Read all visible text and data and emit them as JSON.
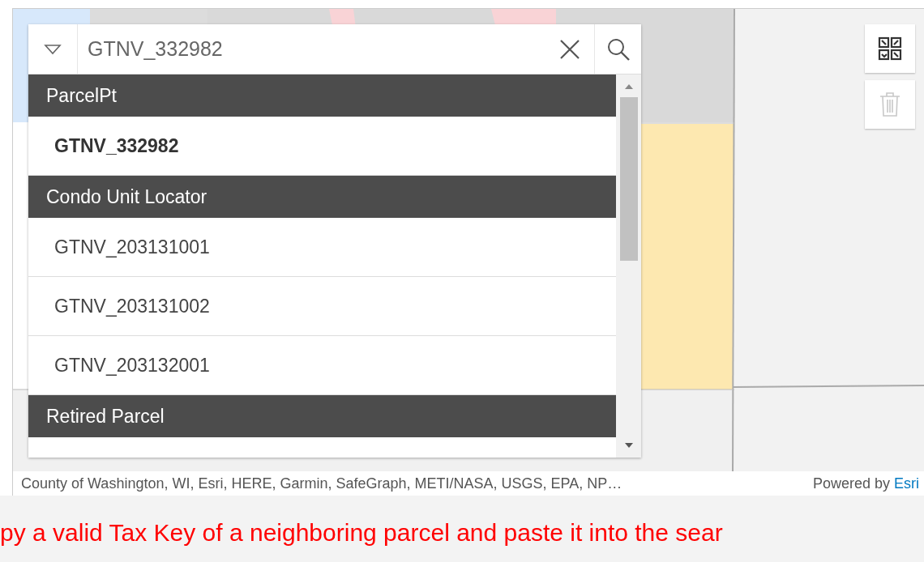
{
  "search": {
    "value": "GTNV_332982"
  },
  "results": [
    {
      "kind": "header",
      "label": "ParcelPt"
    },
    {
      "kind": "item",
      "label": "GTNV_332982",
      "selected": true
    },
    {
      "kind": "header",
      "label": "Condo Unit Locator"
    },
    {
      "kind": "item",
      "label": "GTNV_203131001",
      "selected": false
    },
    {
      "kind": "item",
      "label": "GTNV_203131002",
      "selected": false
    },
    {
      "kind": "item",
      "label": "GTNV_203132001",
      "selected": false
    },
    {
      "kind": "header",
      "label": "Retired Parcel"
    }
  ],
  "map_tools": [
    {
      "kind": "basemap",
      "disabled": false
    },
    {
      "kind": "trash",
      "disabled": true
    }
  ],
  "attribution": {
    "text": "County of Washington, WI, Esri, HERE, Garmin, SafeGraph, METI/NASA, USGS, EPA, NP…",
    "powered_by": "Powered by",
    "link": "Esri"
  },
  "caption": "py a valid Tax Key of a neighboring parcel and paste it into the sear"
}
